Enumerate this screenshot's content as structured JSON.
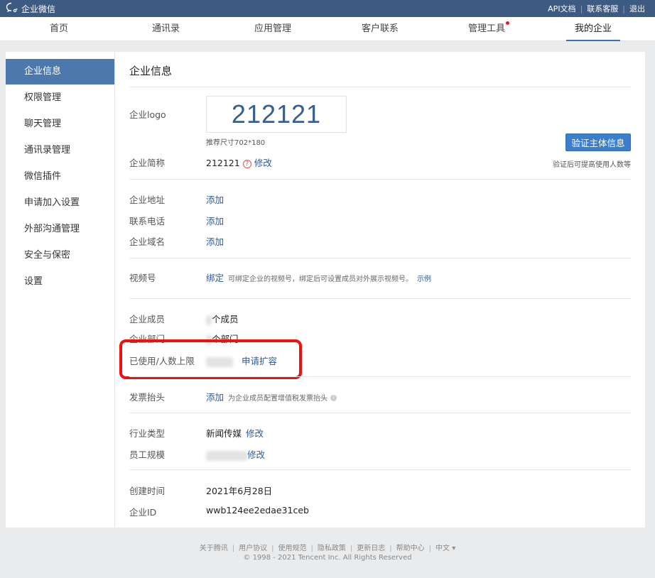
{
  "topbar": {
    "brand": "企业微信",
    "links": [
      "API文档",
      "联系客服",
      "退出"
    ]
  },
  "nav": {
    "items": [
      "首页",
      "通讯录",
      "应用管理",
      "客户联系",
      "管理工具",
      "我的企业"
    ],
    "active": "我的企业"
  },
  "sidebar": {
    "items": [
      "企业信息",
      "权限管理",
      "聊天管理",
      "通讯录管理",
      "微信插件",
      "申请加入设置",
      "外部沟通管理",
      "安全与保密",
      "设置"
    ],
    "active": "企业信息"
  },
  "main": {
    "title": "企业信息",
    "logo": {
      "label": "企业logo",
      "text": "212121",
      "size_hint": "推荐尺寸702*180"
    },
    "verify": {
      "button": "验证主体信息",
      "hint": "验证后可提高使用人数等"
    },
    "short_name": {
      "label": "企业简称",
      "value": "212121",
      "edit": "修改"
    },
    "address": {
      "label": "企业地址",
      "action": "添加"
    },
    "phone": {
      "label": "联系电话",
      "action": "添加"
    },
    "domain": {
      "label": "企业域名",
      "action": "添加"
    },
    "video": {
      "label": "视频号",
      "action": "绑定",
      "hint": "可绑定企业的视频号，绑定后可设置成员对外展示视频号。",
      "example": "示例"
    },
    "members": {
      "label": "企业成员",
      "suffix": "个成员"
    },
    "departments": {
      "label": "企业部门",
      "suffix": "个部门"
    },
    "capacity": {
      "label": "已使用/人数上限",
      "action": "申请扩容"
    },
    "invoice": {
      "label": "发票抬头",
      "action": "添加",
      "hint": "为企业成员配置增值税发票抬头"
    },
    "industry": {
      "label": "行业类型",
      "value": "新闻传媒",
      "edit": "修改"
    },
    "scale": {
      "label": "员工规模",
      "edit": "修改"
    },
    "created": {
      "label": "创建时间",
      "value": "2021年6月28日"
    },
    "corp_id": {
      "label": "企业ID",
      "value": "wwb124ee2edae31ceb"
    }
  },
  "footer": {
    "links": [
      "关于腾讯",
      "用户协议",
      "使用规范",
      "隐私政策",
      "更新日志",
      "帮助中心",
      "中文 ▾"
    ],
    "copyright": "© 1998 - 2021 Tencent Inc. All Rights Reserved"
  },
  "colors": {
    "topbar": "#3d5a82",
    "accent": "#4d78ad",
    "link": "#2c5a97",
    "highlight": "#f01010"
  }
}
